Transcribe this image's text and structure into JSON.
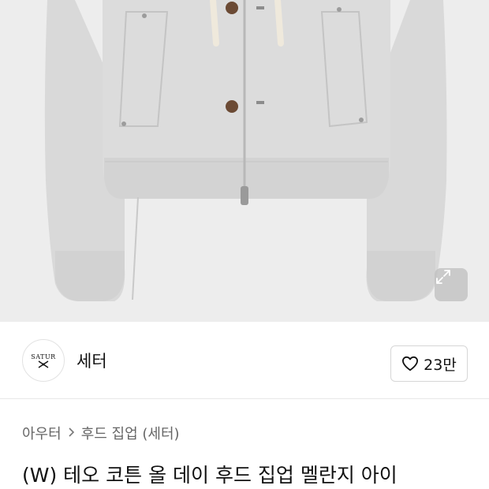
{
  "brand": {
    "logo_text": "SATUR",
    "name": "세터"
  },
  "like": {
    "icon": "heart-outline-icon",
    "count": "23만"
  },
  "breadcrumb": {
    "category": "아우터",
    "subcategory": "후드 집업 (세터)"
  },
  "product": {
    "title": "(W) 테오 코튼 올 데이 후드 집업 멜란지 아이"
  },
  "colors": {
    "background": "#ffffff",
    "image_bg": "#ededed",
    "garment": "#d8d8d8",
    "text_primary": "#111111",
    "text_secondary": "#666666",
    "divider": "#e8e8e8"
  }
}
